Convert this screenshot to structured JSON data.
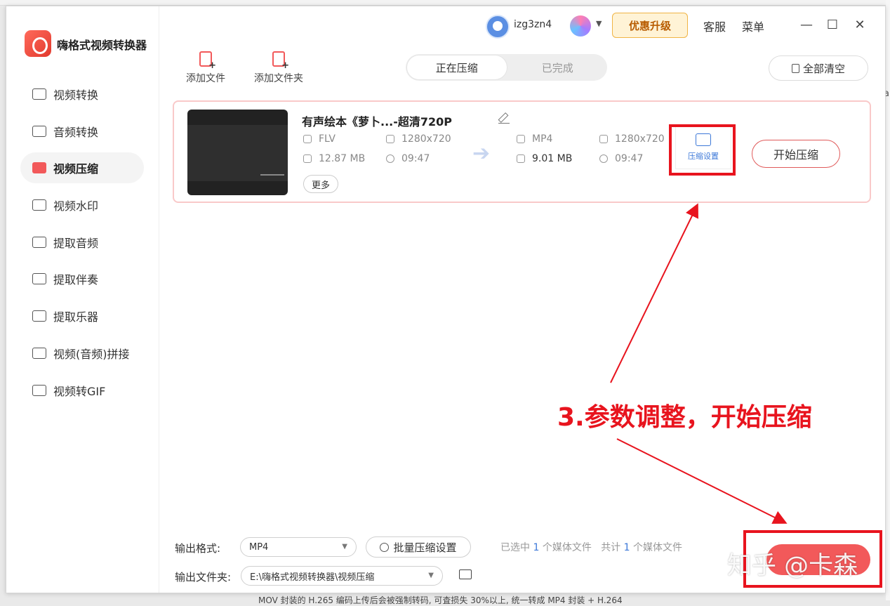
{
  "app": {
    "title": "嗨格式视频转换器"
  },
  "sidebar": {
    "items": [
      {
        "label": "视频转换",
        "icon": "video-convert-icon",
        "active": false
      },
      {
        "label": "音频转换",
        "icon": "audio-convert-icon",
        "active": false
      },
      {
        "label": "视频压缩",
        "icon": "video-compress-icon",
        "active": true
      },
      {
        "label": "视频水印",
        "icon": "watermark-icon",
        "active": false
      },
      {
        "label": "提取音频",
        "icon": "extract-audio-icon",
        "active": false
      },
      {
        "label": "提取伴奏",
        "icon": "extract-accompaniment-icon",
        "active": false
      },
      {
        "label": "提取乐器",
        "icon": "guitar-icon",
        "active": false
      },
      {
        "label": "视频(音频)拼接",
        "icon": "merge-icon",
        "active": false
      },
      {
        "label": "视频转GIF",
        "icon": "gif-icon",
        "active": false
      }
    ]
  },
  "header": {
    "username": "izg3zn4",
    "upgrade_label": "优惠升级",
    "service_label": "客服",
    "menu_label": "菜单",
    "minimize": "—",
    "maximize": "☐",
    "close": "✕",
    "accent_color": "#f2595a"
  },
  "toolbar": {
    "add_file": "添加文件",
    "add_folder": "添加文件夹",
    "tabs": [
      {
        "label": "正在压缩",
        "active": true
      },
      {
        "label": "已完成",
        "active": false
      }
    ],
    "clear_all": "全部清空"
  },
  "task": {
    "file_name": "有声绘本《萝卜...-超清720P",
    "source": {
      "format": "FLV",
      "resolution": "1280x720",
      "size": "12.87 MB",
      "duration": "09:47"
    },
    "output": {
      "format": "MP4",
      "resolution": "1280x720",
      "size": "9.01 MB",
      "duration": "09:47"
    },
    "more_label": "更多",
    "compress_settings_label": "压缩设置",
    "start_label": "开始压缩"
  },
  "footer": {
    "output_format_label": "输出格式:",
    "output_format_value": "MP4",
    "batch_settings_label": "批量压缩设置",
    "stats_prefix": "已选中",
    "selected_count": "1",
    "stats_mid": "个媒体文件",
    "stats_total_prefix": "共计",
    "total_count": "1",
    "stats_suffix": "个媒体文件",
    "output_folder_label": "输出文件夹:",
    "output_folder_value": "E:\\嗨格式视频转换器\\视频压缩"
  },
  "overlay": {
    "annotation": "3.参数调整，开始压缩",
    "watermark": "知乎 @卡森",
    "highlight_color": "#e8141e"
  },
  "background": {
    "bottom_text": "MOV 封装的 H.265 编码上传后会被强制转码, 可査损失 30%以上, 统一转成 MP4 封装 + H.264",
    "right_text": "a"
  }
}
